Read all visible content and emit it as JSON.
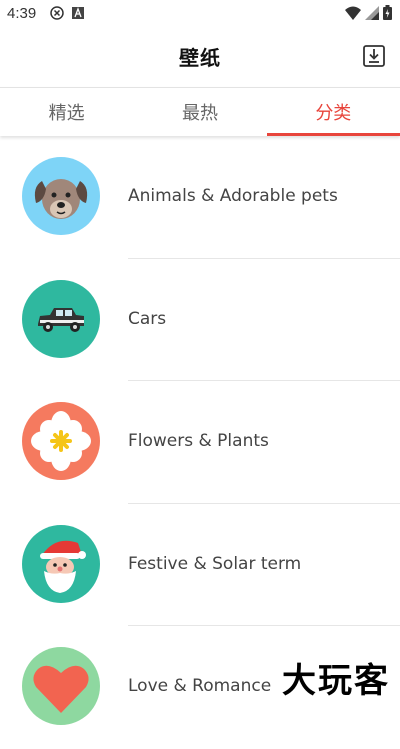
{
  "status_bar": {
    "time": "4:39",
    "icons_left": [
      "vpn-x-icon",
      "a-box-icon"
    ],
    "icons_right": [
      "wifi-icon",
      "signal-icon",
      "battery-icon"
    ]
  },
  "header": {
    "title": "壁纸",
    "download_icon": "download-icon"
  },
  "tabs": [
    {
      "label": "精选",
      "active": false
    },
    {
      "label": "最热",
      "active": false
    },
    {
      "label": "分类",
      "active": true
    }
  ],
  "categories": [
    {
      "label": "Animals & Adorable pets",
      "icon": "dog-icon",
      "bg": "#7ed4f7"
    },
    {
      "label": "Cars",
      "icon": "car-icon",
      "bg": "#2fb89f"
    },
    {
      "label": "Flowers & Plants",
      "icon": "flower-icon",
      "bg": "#f57a5f"
    },
    {
      "label": "Festive & Solar term",
      "icon": "santa-icon",
      "bg": "#2fb89f"
    },
    {
      "label": "Love & Romance",
      "icon": "heart-icon",
      "bg": "#8ed8a0"
    }
  ],
  "watermark": "大玩客",
  "colors": {
    "accent": "#e8453c",
    "divider": "#e6e6e6"
  }
}
